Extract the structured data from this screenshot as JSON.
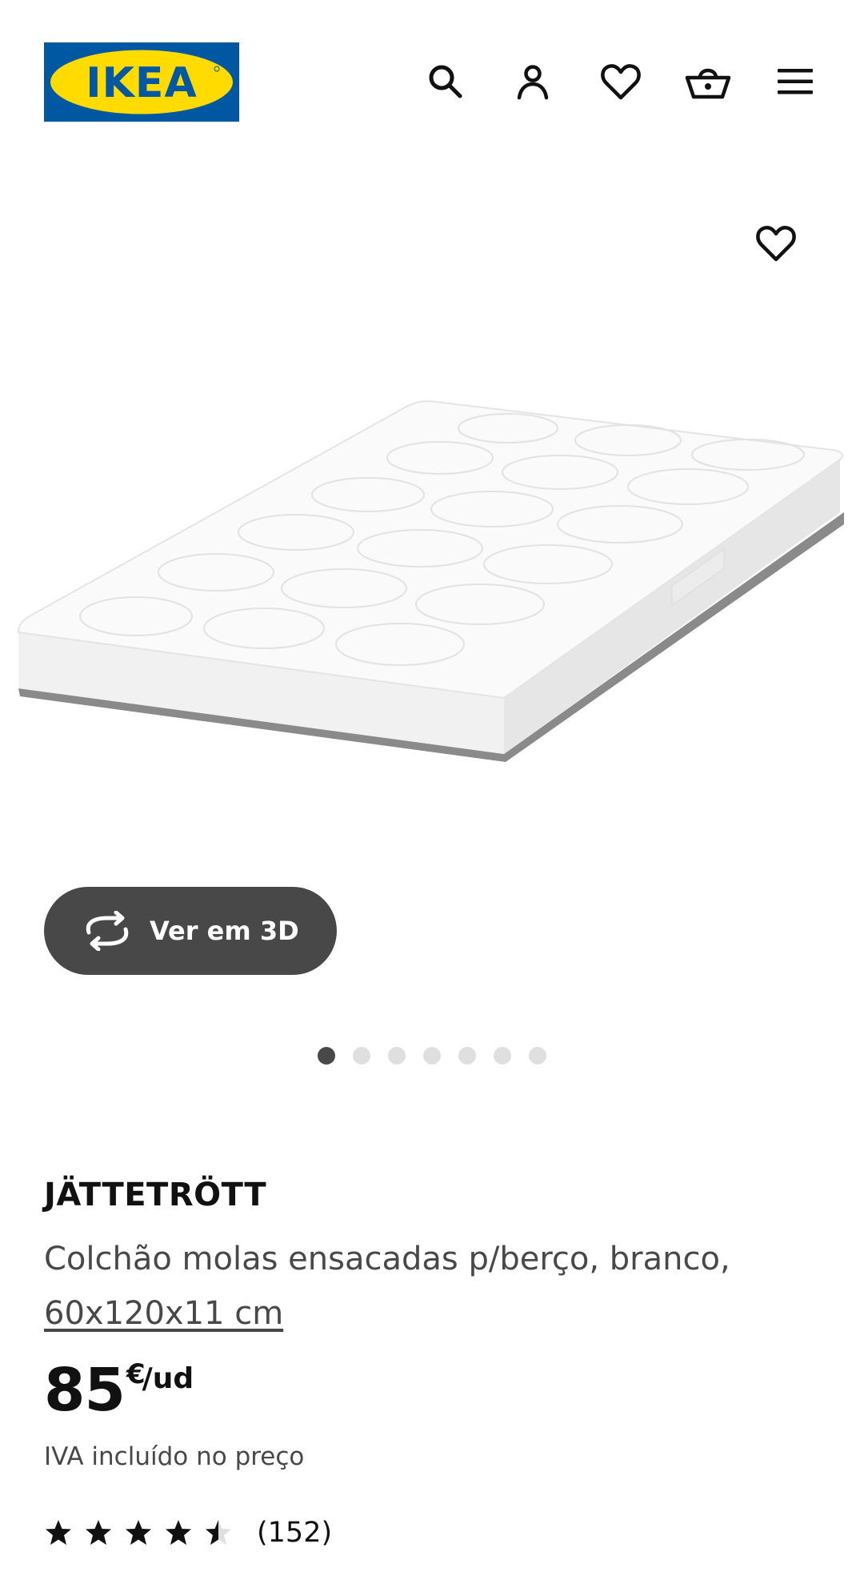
{
  "header": {
    "logo_text": "IKEA",
    "icons": [
      "search-icon",
      "account-icon",
      "heart-icon",
      "basket-icon",
      "menu-icon"
    ]
  },
  "gallery": {
    "favourite_icon": "heart-icon",
    "view_3d_label": "Ver em 3D",
    "view_3d_icon": "rotate-3d-icon",
    "slide_count": 7,
    "active_slide": 1
  },
  "product": {
    "name": "JÄTTETRÖTT",
    "description": "Colchão molas ensacadas p/berço, branco,",
    "size": "60x120x11 cm",
    "price": {
      "integer": "85",
      "currency": "€",
      "unit": "/ud"
    },
    "vat_note": "IVA incluído no preço",
    "rating": {
      "stars": 4.5,
      "max_stars": 5,
      "count": "(152)"
    }
  },
  "colors": {
    "brand_blue": "#0058a3",
    "brand_yellow": "#ffdb00",
    "dark_button": "#484848",
    "dot_inactive": "#dfdfdf"
  }
}
